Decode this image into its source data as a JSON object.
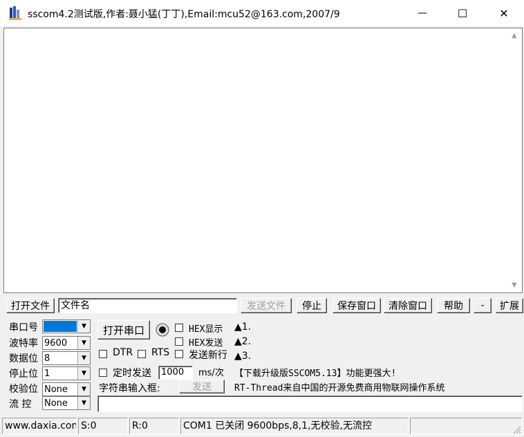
{
  "window": {
    "title": "sscom4.2测试版,作者:聂小猛(丁丁),Email:mcu52@163.com,2007/9",
    "minimize_glyph": "—",
    "maximize_glyph": "☐",
    "close_glyph": "✕"
  },
  "file_row": {
    "open_file": "打开文件",
    "filename_value": "文件名",
    "send_file": "发送文件",
    "stop": "停止",
    "save_window": "保存窗口",
    "clear_window": "清除窗口",
    "help": "帮助",
    "dash": "-",
    "expand": "扩展"
  },
  "port_settings": {
    "port_label": "串口号",
    "port_value": "",
    "baud_label": "波特率",
    "baud_value": "9600",
    "databits_label": "数据位",
    "databits_value": "8",
    "stopbits_label": "停止位",
    "stopbits_value": "1",
    "parity_label": "校验位",
    "parity_value": "None",
    "flow_label": "流 控",
    "flow_value": "None"
  },
  "controls": {
    "open_port": "打开串口",
    "hex_display": "HEX显示",
    "hex_send": "HEX发送",
    "dtr": "DTR",
    "rts": "RTS",
    "send_newline": "发送新行",
    "timed_send": "定时发送",
    "interval_value": "1000",
    "interval_unit": "ms/次",
    "input_label": "字符串输入框:",
    "send_button": "发送"
  },
  "links": {
    "line1": "▲1.",
    "line2": "▲2.",
    "line3": "▲3.",
    "upgrade": "【下载升级版SSCOM5.13】功能更强大!",
    "rtthread": "RT-Thread来自中国的开源免费商用物联网操作系统"
  },
  "statusbar": {
    "website": "www.daxia.com",
    "sent": "S:0",
    "received": "R:0",
    "port_status": "COM1 已关闭  9600bps,8,1,无校验,无流控"
  },
  "colors": {
    "port_selected": "#0078d7"
  }
}
